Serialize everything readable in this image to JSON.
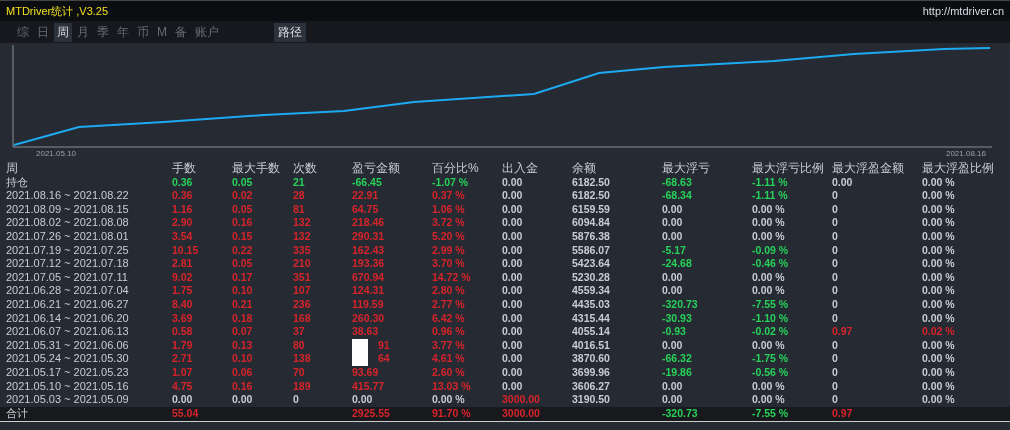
{
  "window": {
    "title": "MTDriver统计 ,V3.25",
    "link": "http://mtdriver.cn"
  },
  "tabs": [
    {
      "label": "综",
      "selected": false
    },
    {
      "label": "日",
      "selected": false
    },
    {
      "label": "周",
      "selected": true
    },
    {
      "label": "月",
      "selected": false
    },
    {
      "label": "季",
      "selected": false
    },
    {
      "label": "年",
      "selected": false
    },
    {
      "label": "币",
      "selected": false
    },
    {
      "label": "M",
      "selected": false
    },
    {
      "label": "备",
      "selected": false
    },
    {
      "label": "账户",
      "selected": false
    }
  ],
  "path_button": "路径",
  "chart": {
    "x_start": "2021.05.10",
    "x_end": "2021.08.16"
  },
  "table": {
    "week_header": "周",
    "columns": [
      "手数",
      "最大手数",
      "次数",
      "盈亏金额",
      "百分比%",
      "出入金",
      "余额",
      "最大浮亏",
      "最大浮亏比例",
      "最大浮盈金额",
      "最大浮盈比例"
    ],
    "rows": [
      {
        "week": "持仓",
        "cells": [
          {
            "text": "0.36",
            "color": "#28d25a"
          },
          {
            "text": "0.05",
            "color": "#28d25a"
          },
          {
            "text": "21",
            "color": "#28d25a"
          },
          {
            "text": "-66.45",
            "color": "#28d25a"
          },
          {
            "text": "-1.07 %",
            "color": "#28d25a"
          },
          {
            "text": "0.00",
            "color": "#c9ccd2"
          },
          {
            "text": "6182.50",
            "color": "#c9ccd2"
          },
          {
            "text": "-68.63",
            "color": "#28d25a"
          },
          {
            "text": "-1.11 %",
            "color": "#28d25a"
          },
          {
            "text": "0.00",
            "color": "#c9ccd2"
          },
          {
            "text": "0.00 %",
            "color": "#c9ccd2"
          }
        ]
      },
      {
        "week": "2021.08.16 ~ 2021.08.22",
        "cells": [
          {
            "text": "0.36",
            "color": "#d7242a"
          },
          {
            "text": "0.02",
            "color": "#d7242a"
          },
          {
            "text": "28",
            "color": "#d7242a"
          },
          {
            "text": "22.91",
            "color": "#d7242a"
          },
          {
            "text": "0.37 %",
            "color": "#d7242a"
          },
          {
            "text": "0.00",
            "color": "#c9ccd2"
          },
          {
            "text": "6182.50",
            "color": "#c9ccd2"
          },
          {
            "text": "-68.34",
            "color": "#28d25a"
          },
          {
            "text": "-1.11 %",
            "color": "#28d25a"
          },
          {
            "text": "0",
            "color": "#c9ccd2"
          },
          {
            "text": "0.00 %",
            "color": "#c9ccd2"
          }
        ]
      },
      {
        "week": "2021.08.09 ~ 2021.08.15",
        "cells": [
          {
            "text": "1.16",
            "color": "#d7242a"
          },
          {
            "text": "0.05",
            "color": "#d7242a"
          },
          {
            "text": "81",
            "color": "#d7242a"
          },
          {
            "text": "64.75",
            "color": "#d7242a"
          },
          {
            "text": "1.06 %",
            "color": "#d7242a"
          },
          {
            "text": "0.00",
            "color": "#c9ccd2"
          },
          {
            "text": "6159.59",
            "color": "#c9ccd2"
          },
          {
            "text": "0.00",
            "color": "#c9ccd2"
          },
          {
            "text": "0.00 %",
            "color": "#c9ccd2"
          },
          {
            "text": "0",
            "color": "#c9ccd2"
          },
          {
            "text": "0.00 %",
            "color": "#c9ccd2"
          }
        ]
      },
      {
        "week": "2021.08.02 ~ 2021.08.08",
        "cells": [
          {
            "text": "2.90",
            "color": "#d7242a"
          },
          {
            "text": "0.16",
            "color": "#d7242a"
          },
          {
            "text": "132",
            "color": "#d7242a"
          },
          {
            "text": "218.46",
            "color": "#d7242a"
          },
          {
            "text": "3.72 %",
            "color": "#d7242a"
          },
          {
            "text": "0.00",
            "color": "#c9ccd2"
          },
          {
            "text": "6094.84",
            "color": "#c9ccd2"
          },
          {
            "text": "0.00",
            "color": "#c9ccd2"
          },
          {
            "text": "0.00 %",
            "color": "#c9ccd2"
          },
          {
            "text": "0",
            "color": "#c9ccd2"
          },
          {
            "text": "0.00 %",
            "color": "#c9ccd2"
          }
        ]
      },
      {
        "week": "2021.07.26 ~ 2021.08.01",
        "cells": [
          {
            "text": "3.54",
            "color": "#d7242a"
          },
          {
            "text": "0.15",
            "color": "#d7242a"
          },
          {
            "text": "132",
            "color": "#d7242a"
          },
          {
            "text": "290.31",
            "color": "#d7242a"
          },
          {
            "text": "5.20 %",
            "color": "#d7242a"
          },
          {
            "text": "0.00",
            "color": "#c9ccd2"
          },
          {
            "text": "5876.38",
            "color": "#c9ccd2"
          },
          {
            "text": "0.00",
            "color": "#c9ccd2"
          },
          {
            "text": "0.00 %",
            "color": "#c9ccd2"
          },
          {
            "text": "0",
            "color": "#c9ccd2"
          },
          {
            "text": "0.00 %",
            "color": "#c9ccd2"
          }
        ]
      },
      {
        "week": "2021.07.19 ~ 2021.07.25",
        "cells": [
          {
            "text": "10.15",
            "color": "#d7242a"
          },
          {
            "text": "0.22",
            "color": "#d7242a"
          },
          {
            "text": "335",
            "color": "#d7242a"
          },
          {
            "text": "162.43",
            "color": "#d7242a"
          },
          {
            "text": "2.99 %",
            "color": "#d7242a"
          },
          {
            "text": "0.00",
            "color": "#c9ccd2"
          },
          {
            "text": "5586.07",
            "color": "#c9ccd2"
          },
          {
            "text": "-5.17",
            "color": "#28d25a"
          },
          {
            "text": "-0.09 %",
            "color": "#28d25a"
          },
          {
            "text": "0",
            "color": "#c9ccd2"
          },
          {
            "text": "0.00 %",
            "color": "#c9ccd2"
          }
        ]
      },
      {
        "week": "2021.07.12 ~ 2021.07.18",
        "cells": [
          {
            "text": "2.81",
            "color": "#d7242a"
          },
          {
            "text": "0.05",
            "color": "#d7242a"
          },
          {
            "text": "210",
            "color": "#d7242a"
          },
          {
            "text": "193.36",
            "color": "#d7242a"
          },
          {
            "text": "3.70 %",
            "color": "#d7242a"
          },
          {
            "text": "0.00",
            "color": "#c9ccd2"
          },
          {
            "text": "5423.64",
            "color": "#c9ccd2"
          },
          {
            "text": "-24.68",
            "color": "#28d25a"
          },
          {
            "text": "-0.46 %",
            "color": "#28d25a"
          },
          {
            "text": "0",
            "color": "#c9ccd2"
          },
          {
            "text": "0.00 %",
            "color": "#c9ccd2"
          }
        ]
      },
      {
        "week": "2021.07.05 ~ 2021.07.11",
        "cells": [
          {
            "text": "9.02",
            "color": "#d7242a"
          },
          {
            "text": "0.17",
            "color": "#d7242a"
          },
          {
            "text": "351",
            "color": "#d7242a"
          },
          {
            "text": "670.94",
            "color": "#d7242a"
          },
          {
            "text": "14.72 %",
            "color": "#d7242a"
          },
          {
            "text": "0.00",
            "color": "#c9ccd2"
          },
          {
            "text": "5230.28",
            "color": "#c9ccd2"
          },
          {
            "text": "0.00",
            "color": "#c9ccd2"
          },
          {
            "text": "0.00 %",
            "color": "#c9ccd2"
          },
          {
            "text": "0",
            "color": "#c9ccd2"
          },
          {
            "text": "0.00 %",
            "color": "#c9ccd2"
          }
        ]
      },
      {
        "week": "2021.06.28 ~ 2021.07.04",
        "cells": [
          {
            "text": "1.75",
            "color": "#d7242a"
          },
          {
            "text": "0.10",
            "color": "#d7242a"
          },
          {
            "text": "107",
            "color": "#d7242a"
          },
          {
            "text": "124.31",
            "color": "#d7242a"
          },
          {
            "text": "2.80 %",
            "color": "#d7242a"
          },
          {
            "text": "0.00",
            "color": "#c9ccd2"
          },
          {
            "text": "4559.34",
            "color": "#c9ccd2"
          },
          {
            "text": "0.00",
            "color": "#c9ccd2"
          },
          {
            "text": "0.00 %",
            "color": "#c9ccd2"
          },
          {
            "text": "0",
            "color": "#c9ccd2"
          },
          {
            "text": "0.00 %",
            "color": "#c9ccd2"
          }
        ]
      },
      {
        "week": "2021.06.21 ~ 2021.06.27",
        "cells": [
          {
            "text": "8.40",
            "color": "#d7242a"
          },
          {
            "text": "0.21",
            "color": "#d7242a"
          },
          {
            "text": "236",
            "color": "#d7242a"
          },
          {
            "text": "119.59",
            "color": "#d7242a"
          },
          {
            "text": "2.77 %",
            "color": "#d7242a"
          },
          {
            "text": "0.00",
            "color": "#c9ccd2"
          },
          {
            "text": "4435.03",
            "color": "#c9ccd2"
          },
          {
            "text": "-320.73",
            "color": "#28d25a"
          },
          {
            "text": "-7.55 %",
            "color": "#28d25a"
          },
          {
            "text": "0",
            "color": "#c9ccd2"
          },
          {
            "text": "0.00 %",
            "color": "#c9ccd2"
          }
        ]
      },
      {
        "week": "2021.06.14 ~ 2021.06.20",
        "cells": [
          {
            "text": "3.69",
            "color": "#d7242a"
          },
          {
            "text": "0.18",
            "color": "#d7242a"
          },
          {
            "text": "168",
            "color": "#d7242a"
          },
          {
            "text": "260.30",
            "color": "#d7242a"
          },
          {
            "text": "6.42 %",
            "color": "#d7242a"
          },
          {
            "text": "0.00",
            "color": "#c9ccd2"
          },
          {
            "text": "4315.44",
            "color": "#c9ccd2"
          },
          {
            "text": "-30.93",
            "color": "#28d25a"
          },
          {
            "text": "-1.10 %",
            "color": "#28d25a"
          },
          {
            "text": "0",
            "color": "#c9ccd2"
          },
          {
            "text": "0.00 %",
            "color": "#c9ccd2"
          }
        ]
      },
      {
        "week": "2021.06.07 ~ 2021.06.13",
        "cells": [
          {
            "text": "0.58",
            "color": "#d7242a"
          },
          {
            "text": "0.07",
            "color": "#d7242a"
          },
          {
            "text": "37",
            "color": "#d7242a"
          },
          {
            "text": "38.63",
            "color": "#d7242a"
          },
          {
            "text": "0.96 %",
            "color": "#d7242a"
          },
          {
            "text": "0.00",
            "color": "#c9ccd2"
          },
          {
            "text": "4055.14",
            "color": "#c9ccd2"
          },
          {
            "text": "-0.93",
            "color": "#28d25a"
          },
          {
            "text": "-0.02 %",
            "color": "#28d25a"
          },
          {
            "text": "0.97",
            "color": "#d7242a"
          },
          {
            "text": "0.02 %",
            "color": "#d7242a"
          }
        ]
      },
      {
        "week": "2021.05.31 ~ 2021.06.06",
        "cells": [
          {
            "text": "1.79",
            "color": "#d7242a"
          },
          {
            "text": "0.13",
            "color": "#d7242a"
          },
          {
            "text": "80",
            "color": "#d7242a"
          },
          {
            "text": "91",
            "color": "#d7242a",
            "covered": true
          },
          {
            "text": "3.77 %",
            "color": "#d7242a"
          },
          {
            "text": "0.00",
            "color": "#c9ccd2"
          },
          {
            "text": "4016.51",
            "color": "#c9ccd2"
          },
          {
            "text": "0.00",
            "color": "#c9ccd2"
          },
          {
            "text": "0.00 %",
            "color": "#c9ccd2"
          },
          {
            "text": "0",
            "color": "#c9ccd2"
          },
          {
            "text": "0.00 %",
            "color": "#c9ccd2"
          }
        ]
      },
      {
        "week": "2021.05.24 ~ 2021.05.30",
        "cells": [
          {
            "text": "2.71",
            "color": "#d7242a"
          },
          {
            "text": "0.10",
            "color": "#d7242a"
          },
          {
            "text": "138",
            "color": "#d7242a"
          },
          {
            "text": "64",
            "color": "#d7242a",
            "covered": true
          },
          {
            "text": "4.61 %",
            "color": "#d7242a"
          },
          {
            "text": "0.00",
            "color": "#c9ccd2"
          },
          {
            "text": "3870.60",
            "color": "#c9ccd2"
          },
          {
            "text": "-66.32",
            "color": "#28d25a"
          },
          {
            "text": "-1.75 %",
            "color": "#28d25a"
          },
          {
            "text": "0",
            "color": "#c9ccd2"
          },
          {
            "text": "0.00 %",
            "color": "#c9ccd2"
          }
        ]
      },
      {
        "week": "2021.05.17 ~ 2021.05.23",
        "cells": [
          {
            "text": "1.07",
            "color": "#d7242a"
          },
          {
            "text": "0.06",
            "color": "#d7242a"
          },
          {
            "text": "70",
            "color": "#d7242a"
          },
          {
            "text": "93.69",
            "color": "#d7242a"
          },
          {
            "text": "2.60 %",
            "color": "#d7242a"
          },
          {
            "text": "0.00",
            "color": "#c9ccd2"
          },
          {
            "text": "3699.96",
            "color": "#c9ccd2"
          },
          {
            "text": "-19.86",
            "color": "#28d25a"
          },
          {
            "text": "-0.56 %",
            "color": "#28d25a"
          },
          {
            "text": "0",
            "color": "#c9ccd2"
          },
          {
            "text": "0.00 %",
            "color": "#c9ccd2"
          }
        ]
      },
      {
        "week": "2021.05.10 ~ 2021.05.16",
        "cells": [
          {
            "text": "4.75",
            "color": "#d7242a"
          },
          {
            "text": "0.16",
            "color": "#d7242a"
          },
          {
            "text": "189",
            "color": "#d7242a"
          },
          {
            "text": "415.77",
            "color": "#d7242a"
          },
          {
            "text": "13.03 %",
            "color": "#d7242a"
          },
          {
            "text": "0.00",
            "color": "#c9ccd2"
          },
          {
            "text": "3606.27",
            "color": "#c9ccd2"
          },
          {
            "text": "0.00",
            "color": "#c9ccd2"
          },
          {
            "text": "0.00 %",
            "color": "#c9ccd2"
          },
          {
            "text": "0",
            "color": "#c9ccd2"
          },
          {
            "text": "0.00 %",
            "color": "#c9ccd2"
          }
        ]
      },
      {
        "week": "2021.05.03 ~ 2021.05.09",
        "cells": [
          {
            "text": "0.00",
            "color": "#c9ccd2"
          },
          {
            "text": "0.00",
            "color": "#c9ccd2"
          },
          {
            "text": "0",
            "color": "#c9ccd2"
          },
          {
            "text": "0.00",
            "color": "#c9ccd2"
          },
          {
            "text": "0.00 %",
            "color": "#c9ccd2"
          },
          {
            "text": "3000.00",
            "color": "#d7242a"
          },
          {
            "text": "3190.50",
            "color": "#c9ccd2"
          },
          {
            "text": "0.00",
            "color": "#c9ccd2"
          },
          {
            "text": "0.00 %",
            "color": "#c9ccd2"
          },
          {
            "text": "0",
            "color": "#c9ccd2"
          },
          {
            "text": "0.00 %",
            "color": "#c9ccd2"
          }
        ]
      }
    ],
    "total": {
      "week": "合计",
      "cells": [
        {
          "text": "55.04",
          "color": "#d7242a"
        },
        null,
        null,
        {
          "text": "2925.55",
          "color": "#d7242a"
        },
        {
          "text": "91.70 %",
          "color": "#d7242a"
        },
        {
          "text": "3000.00",
          "color": "#d7242a"
        },
        null,
        {
          "text": "-320.73",
          "color": "#28d25a"
        },
        {
          "text": "-7.55 %",
          "color": "#28d25a"
        },
        {
          "text": "0.97",
          "color": "#d7242a"
        },
        null
      ]
    }
  }
}
